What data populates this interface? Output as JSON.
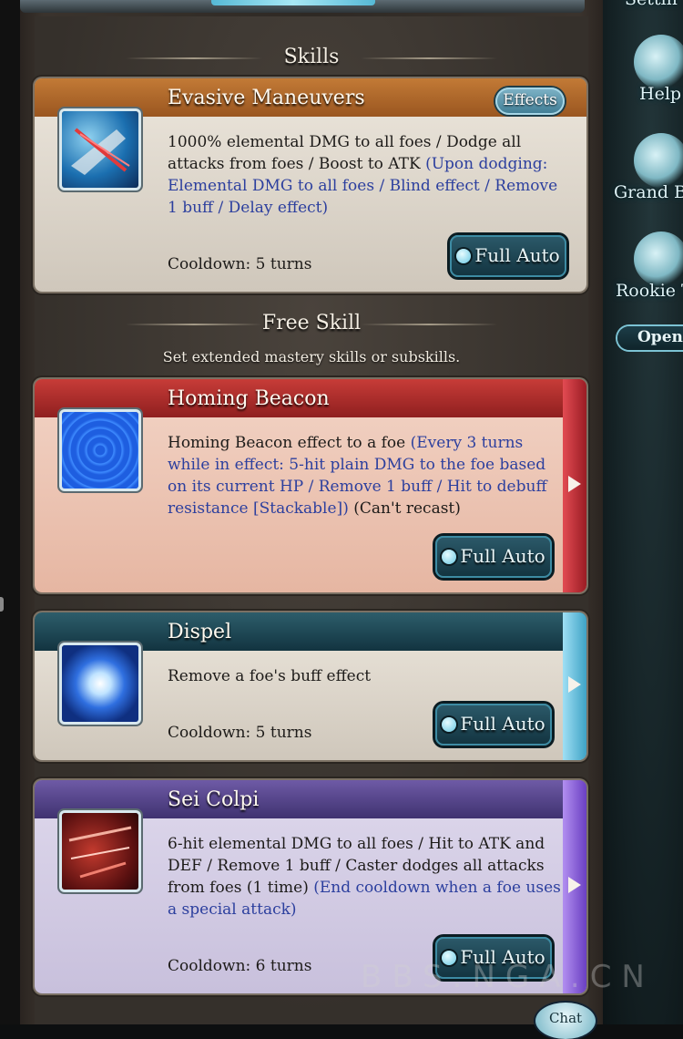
{
  "sections": {
    "skills_title": "Skills",
    "free_skill_title": "Free Skill",
    "free_skill_subtitle": "Set extended mastery skills or subskills."
  },
  "skills": [
    {
      "name": "Evasive Maneuvers",
      "effects_button": "Effects",
      "description_plain": "1000% elemental DMG to all foes / Dodge all attacks from foes / Boost to ATK ",
      "description_highlight": "(Upon dodging: Elemental DMG to all foes / Blind effect / Remove 1 buff / Delay effect)",
      "cooldown": "Cooldown: 5 turns",
      "full_auto": "Full Auto",
      "icon": "evasive-maneuvers-icon"
    },
    {
      "name": "Homing Beacon",
      "description_plain": "Homing Beacon effect to a foe ",
      "description_highlight": "(Every 3 turns while in effect: 5-hit plain DMG to the foe based on its current HP / Remove 1 buff / Hit to debuff resistance [Stackable])",
      "description_tail": " (Can't recast)",
      "full_auto": "Full Auto",
      "icon": "homing-beacon-icon"
    },
    {
      "name": "Dispel",
      "description_plain": "Remove a foe's buff effect",
      "cooldown": "Cooldown: 5 turns",
      "full_auto": "Full Auto",
      "icon": "dispel-icon"
    },
    {
      "name": "Sei Colpi",
      "description_plain": "6-hit elemental DMG to all foes / Hit to ATK and DEF / Remove 1 buff / Caster dodges all attacks from foes (1 time) ",
      "description_highlight": "(End cooldown when a foe uses a special attack)",
      "cooldown": "Cooldown: 6 turns",
      "full_auto": "Full Auto",
      "icon": "sei-colpi-icon"
    }
  ],
  "sidebar": {
    "settings": "Settin",
    "help": "Help",
    "grand_blues": "Grand Blu",
    "rookie": "Rookie T",
    "open": "Open"
  },
  "watermark": "BBS.NGA.CN",
  "chat": "Chat",
  "colors": {
    "card1_head": "#b3672a",
    "card2_head": "#b8302e",
    "card3_head": "#1f4a57",
    "card4_head": "#5b4a8e",
    "highlight_text": "#2c3f9e"
  }
}
